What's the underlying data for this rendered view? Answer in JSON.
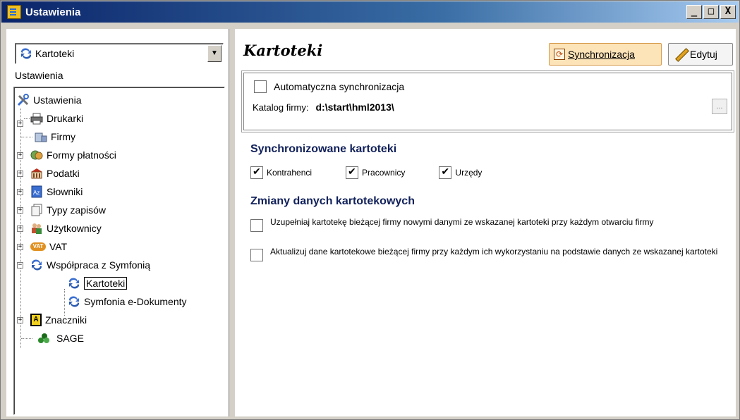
{
  "window": {
    "title": "Ustawienia",
    "controls": [
      "_",
      "□",
      "X"
    ]
  },
  "left": {
    "combo_value": "Kartoteki",
    "section_label": "Ustawienia",
    "tree": [
      {
        "label": "Ustawienia",
        "icon": "tools-icon"
      },
      {
        "label": "Drukarki",
        "icon": "printer-icon"
      },
      {
        "label": "Firmy",
        "icon": "company-icon"
      },
      {
        "label": "Formy płatności",
        "icon": "payment-icon"
      },
      {
        "label": "Podatki",
        "icon": "tax-icon"
      },
      {
        "label": "Słowniki",
        "icon": "dictionary-icon"
      },
      {
        "label": "Typy zapisów",
        "icon": "documents-icon"
      },
      {
        "label": "Użytkownicy",
        "icon": "users-icon"
      },
      {
        "label": "VAT",
        "icon": "vat-icon",
        "icon_text": "VAT"
      },
      {
        "label": "Współpraca z Symfonią",
        "icon": "sync-icon"
      },
      {
        "label": "Kartoteki",
        "icon": "sync-icon"
      },
      {
        "label": "Symfonia e-Dokumenty",
        "icon": "sync-icon"
      },
      {
        "label": "Znaczniki",
        "icon": "tag-icon",
        "icon_text": "A"
      },
      {
        "label": "SAGE",
        "icon": "sage-icon"
      }
    ]
  },
  "right": {
    "heading": "Kartoteki",
    "sync_button": "Synchronizacja",
    "edit_button": "Edytuj",
    "auto_sync_label": "Automatyczna synchronizacja",
    "auto_sync_checked": false,
    "company_dir_label": "Katalog firmy:",
    "company_dir_value": "d:\\start\\hml2013\\",
    "dots_label": "...",
    "synced_title": "Synchronizowane kartoteki",
    "synced_items": [
      {
        "label": "Kontrahenci",
        "checked": true
      },
      {
        "label": "Pracownicy",
        "checked": true
      },
      {
        "label": "Urzędy",
        "checked": true
      }
    ],
    "changes_title": "Zmiany danych kartotekowych",
    "option1": "Uzupełniaj kartotekę bieżącej firmy nowymi danymi ze wskazanej kartoteki przy każdym otwarciu firmy",
    "option1_checked": false,
    "option2": "Aktualizuj dane kartotekowe bieżącej firmy przy każdym ich wykorzystaniu na podstawie danych ze wskazanej kartoteki",
    "option2_checked": false
  },
  "colors": {
    "accent": "#0a246a",
    "section_title": "#10205a",
    "sync_button_bg": "#fde3b8"
  }
}
